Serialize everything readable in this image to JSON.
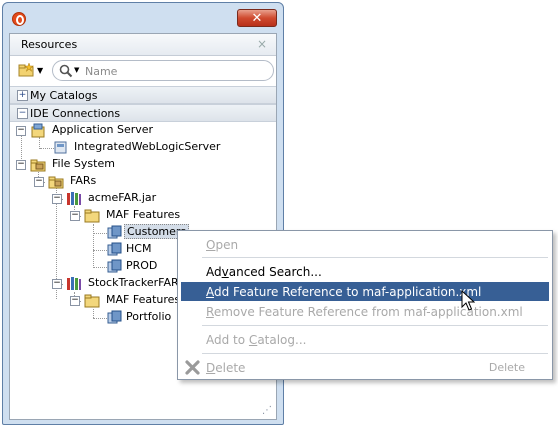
{
  "window": {
    "panel_title": "Resources",
    "tab_close_glyph": "×",
    "close_glyph": "✕"
  },
  "toolbar": {
    "search_placeholder": "Name",
    "new_icon": "new-folder-icon",
    "search_icon": "search-icon"
  },
  "sections": {
    "my_catalogs": {
      "toggle": "+",
      "label": "My Catalogs"
    },
    "ide_connections": {
      "toggle": "−",
      "label": "IDE Connections"
    }
  },
  "tree": {
    "application_server": "Application Server",
    "integrated_server": "IntegratedWebLogicServer",
    "file_system": "File System",
    "fars": "FARs",
    "acme_jar": "acmeFAR.jar",
    "maf_features_1": "MAF Features",
    "customers": "Customers",
    "hcm": "HCM",
    "prod": "PROD",
    "stocktracker_jar": "StockTrackerFAR.j",
    "maf_features_2": "MAF Features",
    "portfolio": "Portfolio"
  },
  "menu": {
    "open": {
      "label_pre": "",
      "label_u": "O",
      "label_post": "pen"
    },
    "advanced_search": {
      "label_pre": "Ad",
      "label_u": "v",
      "label_post": "anced Search..."
    },
    "add_feature_ref": {
      "label_pre": "",
      "label_u": "A",
      "label_post": "dd Feature Reference to maf-application.xml"
    },
    "remove_feature_ref": {
      "label_pre": "",
      "label_u": "R",
      "label_post": "emove Feature Reference from maf-application.xml"
    },
    "add_to_catalog": {
      "label_pre": "Add to ",
      "label_u": "C",
      "label_post": "atalog..."
    },
    "delete": {
      "label_pre": "",
      "label_u": "D",
      "label_post": "elete",
      "accelerator": "Delete"
    }
  },
  "colors": {
    "menu_highlight": "#375f95",
    "disabled_text": "#a9a9a9",
    "close_button": "#cf4a2f",
    "window_frame": "#cfdff0"
  }
}
